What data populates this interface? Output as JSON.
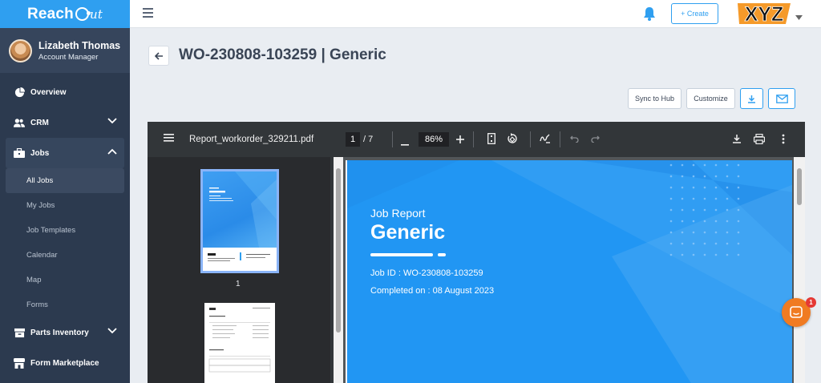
{
  "brand": {
    "name_main": "Reach",
    "name_tail": "ut"
  },
  "user": {
    "name": "Lizabeth Thomas",
    "role": "Account Manager"
  },
  "nav": {
    "overview": "Overview",
    "crm": "CRM",
    "jobs": "Jobs",
    "jobs_sub": [
      "All Jobs",
      "My Jobs",
      "Job Templates",
      "Calendar",
      "Map",
      "Forms"
    ],
    "parts_inventory": "Parts Inventory",
    "form_marketplace": "Form Marketplace"
  },
  "topbar": {
    "create_label": "+ Create",
    "logo_text": "XYZ"
  },
  "page": {
    "title": "WO-230808-103259 | Generic"
  },
  "actions": {
    "sync_label": "Sync to Hub",
    "customize_label": "Customize"
  },
  "pdf": {
    "file_name": "Report_workorder_329211.pdf",
    "current_page": "1",
    "total_pages": "/ 7",
    "zoom": "86%",
    "thumb_label": "1",
    "report": {
      "label": "Job Report",
      "title": "Generic",
      "job_id": "Job ID : WO-230808-103259",
      "completed": "Completed on : 08 August 2023"
    }
  },
  "chat": {
    "badge": "1"
  },
  "colors": {
    "accent": "#2f9ff0",
    "sidebar": "#2c3a4f",
    "report_blue": "#2196f3",
    "chat": "#f07b22"
  }
}
